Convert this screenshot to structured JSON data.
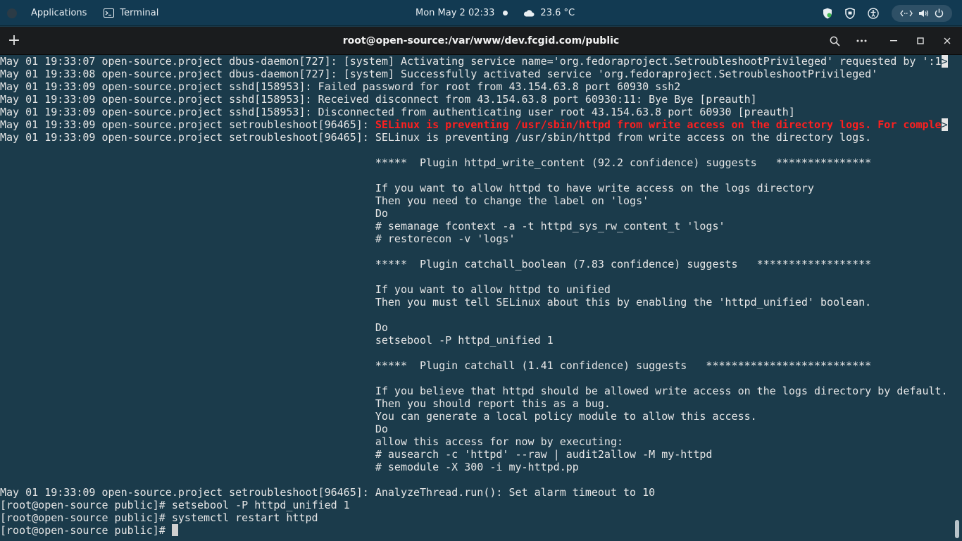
{
  "topbar": {
    "applications": "Applications",
    "app_name": "Terminal",
    "clock": "Mon May 2  02:33",
    "weather": "23.6 °C"
  },
  "window": {
    "title": "root@open-source:/var/www/dev.fcgid.com/public"
  },
  "terminal": {
    "lines": [
      {
        "t": "May 01 19:33:07 open-source.project dbus-daemon[727]: [system] Activating service name='org.fedoraproject.SetroubleshootPrivileged' requested by ':1"
      },
      {
        "t": "May 01 19:33:08 open-source.project dbus-daemon[727]: [system] Successfully activated service 'org.fedoraproject.SetroubleshootPrivileged'"
      },
      {
        "t": "May 01 19:33:09 open-source.project sshd[158953]: Failed password for root from 43.154.63.8 port 60930 ssh2"
      },
      {
        "t": "May 01 19:33:09 open-source.project sshd[158953]: Received disconnect from 43.154.63.8 port 60930:11: Bye Bye [preauth]"
      },
      {
        "t": "May 01 19:33:09 open-source.project sshd[158953]: Disconnected from authenticating user root 43.154.63.8 port 60930 [preauth]"
      },
      {
        "t": "May 01 19:33:09 open-source.project setroubleshoot[96465]: ",
        "red": "SELinux is preventing /usr/sbin/httpd from write access on the directory logs. For comple"
      },
      {
        "t": "May 01 19:33:09 open-source.project setroubleshoot[96465]: SELinux is preventing /usr/sbin/httpd from write access on the directory logs."
      },
      {
        "t": ""
      },
      {
        "t": "                                                           *****  Plugin httpd_write_content (92.2 confidence) suggests   ***************"
      },
      {
        "t": ""
      },
      {
        "t": "                                                           If you want to allow httpd to have write access on the logs directory"
      },
      {
        "t": "                                                           Then you need to change the label on 'logs'"
      },
      {
        "t": "                                                           Do"
      },
      {
        "t": "                                                           # semanage fcontext -a -t httpd_sys_rw_content_t 'logs'"
      },
      {
        "t": "                                                           # restorecon -v 'logs'"
      },
      {
        "t": ""
      },
      {
        "t": "                                                           *****  Plugin catchall_boolean (7.83 confidence) suggests   ******************"
      },
      {
        "t": ""
      },
      {
        "t": "                                                           If you want to allow httpd to unified"
      },
      {
        "t": "                                                           Then you must tell SELinux about this by enabling the 'httpd_unified' boolean."
      },
      {
        "t": ""
      },
      {
        "t": "                                                           Do"
      },
      {
        "t": "                                                           setsebool -P httpd_unified 1"
      },
      {
        "t": ""
      },
      {
        "t": "                                                           *****  Plugin catchall (1.41 confidence) suggests   **************************"
      },
      {
        "t": ""
      },
      {
        "t": "                                                           If you believe that httpd should be allowed write access on the logs directory by default."
      },
      {
        "t": "                                                           Then you should report this as a bug."
      },
      {
        "t": "                                                           You can generate a local policy module to allow this access."
      },
      {
        "t": "                                                           Do"
      },
      {
        "t": "                                                           allow this access for now by executing:"
      },
      {
        "t": "                                                           # ausearch -c 'httpd' --raw | audit2allow -M my-httpd"
      },
      {
        "t": "                                                           # semodule -X 300 -i my-httpd.pp"
      },
      {
        "t": ""
      },
      {
        "t": "May 01 19:33:09 open-source.project setroubleshoot[96465]: AnalyzeThread.run(): Set alarm timeout to 10"
      },
      {
        "t": "[root@open-source public]# setsebool -P httpd_unified 1"
      },
      {
        "t": "[root@open-source public]# systemctl restart httpd"
      },
      {
        "t": "[root@open-source public]# ",
        "cursor": true
      }
    ],
    "overflow_marker": ">",
    "overflow_lines": [
      0,
      5
    ]
  },
  "icons": {
    "activities": "activities-icon",
    "terminal": "terminal-icon",
    "weather": "cloud-icon",
    "tray": [
      "shield-check-icon",
      "shield-icon",
      "accessibility-icon",
      "network-icon",
      "volume-icon",
      "power-icon"
    ],
    "window": [
      "new-tab-icon",
      "search-icon",
      "menu-icon",
      "minimize-icon",
      "maximize-icon",
      "close-icon"
    ]
  }
}
